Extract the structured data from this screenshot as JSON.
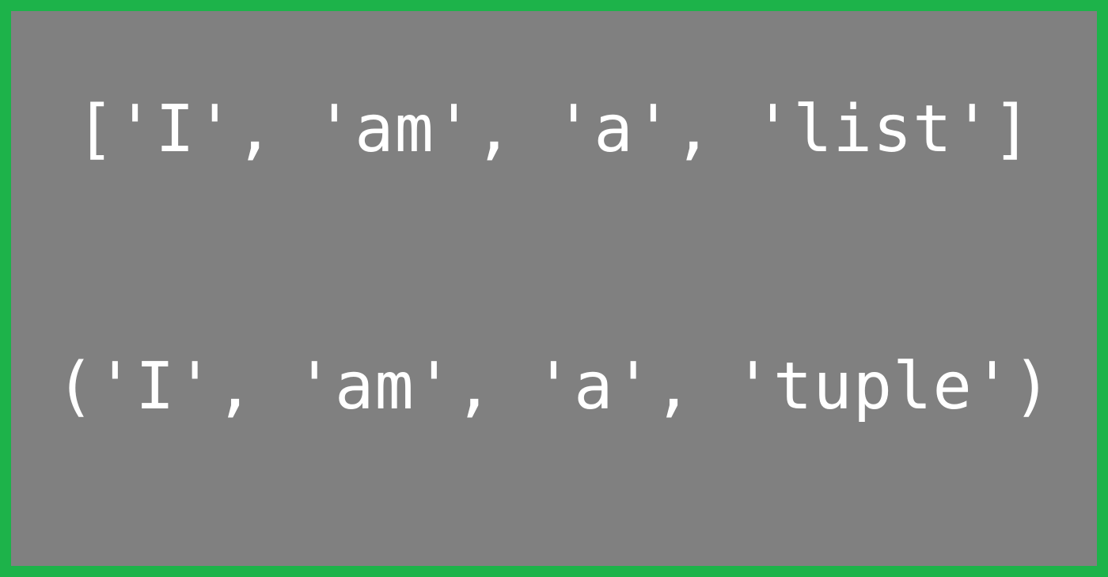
{
  "code": {
    "list_line": "['I', 'am', 'a', 'list']",
    "tuple_line": "('I', 'am', 'a', 'tuple')"
  },
  "colors": {
    "border": "#1db34a",
    "background": "#808080",
    "text": "#ffffff"
  }
}
